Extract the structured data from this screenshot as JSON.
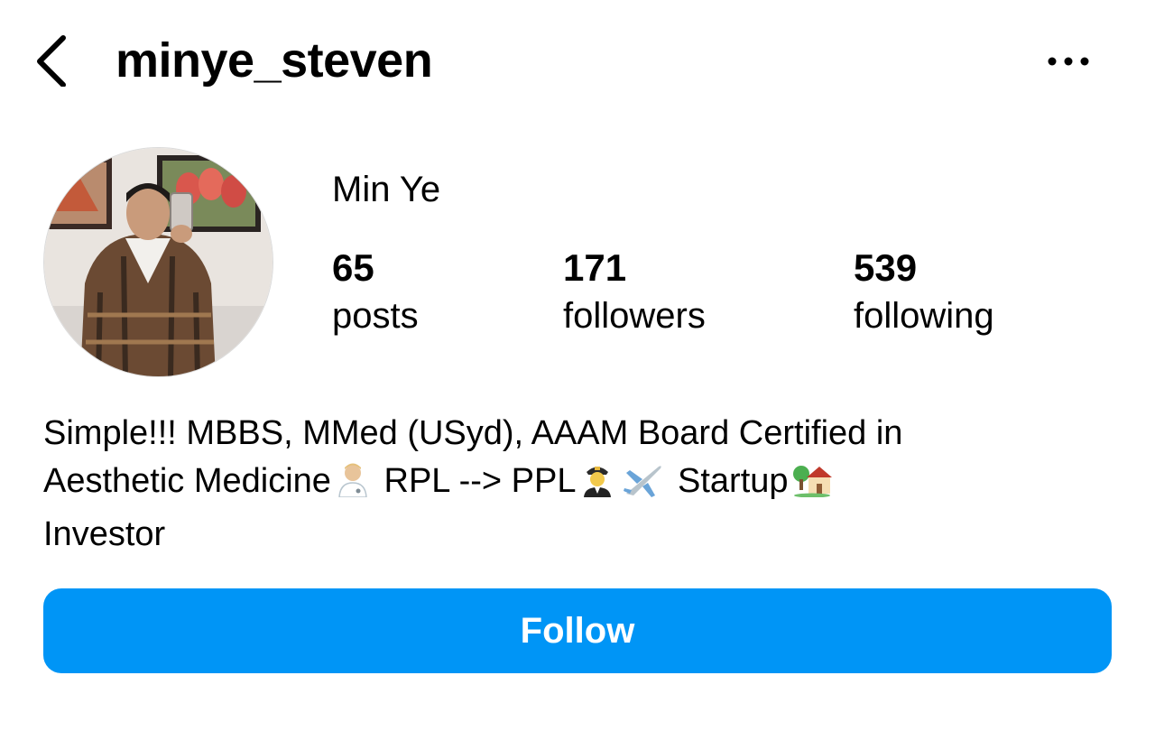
{
  "header": {
    "username": "minye_steven",
    "back_icon": "chevron-left-icon",
    "more_icon": "more-horizontal-icon"
  },
  "profile": {
    "full_name": "Min Ye",
    "avatar": "profile-photo",
    "stats": {
      "posts": {
        "value": "65",
        "label": "posts"
      },
      "followers": {
        "value": "171",
        "label": "followers"
      },
      "following": {
        "value": "539",
        "label": "following"
      }
    },
    "bio": {
      "line1": "Simple!!! MBBS, MMed (USyd), AAAM Board Certified in",
      "line2_part1": "Aesthetic Medicine",
      "line2_part2": " RPL --> PPL",
      "line2_part3": " Startup",
      "line3": "Investor",
      "emojis": [
        "health-worker-emoji",
        "pilot-emoji",
        "airplane-emoji",
        "house-with-garden-emoji"
      ]
    }
  },
  "actions": {
    "follow_label": "Follow"
  },
  "colors": {
    "accent": "#0095f6",
    "text": "#000000",
    "background": "#ffffff"
  }
}
